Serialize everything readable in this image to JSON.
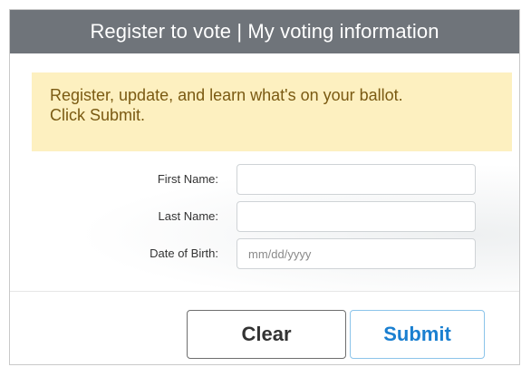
{
  "header": {
    "title": "Register to vote | My voting information"
  },
  "notice": {
    "line1": "Register, update, and learn what's on your ballot.",
    "line2": "Click Submit."
  },
  "form": {
    "first_name": {
      "label": "First Name:",
      "value": "",
      "placeholder": ""
    },
    "last_name": {
      "label": "Last Name:",
      "value": "",
      "placeholder": ""
    },
    "dob": {
      "label": "Date of Birth:",
      "value": "",
      "placeholder": "mm/dd/yyyy"
    }
  },
  "buttons": {
    "clear_label": "Clear",
    "submit_label": "Submit"
  },
  "colors": {
    "header_bg": "#6f747a",
    "notice_bg": "#fdf0c0",
    "notice_text": "#7a5a12",
    "submit_text": "#1a7fd0"
  }
}
